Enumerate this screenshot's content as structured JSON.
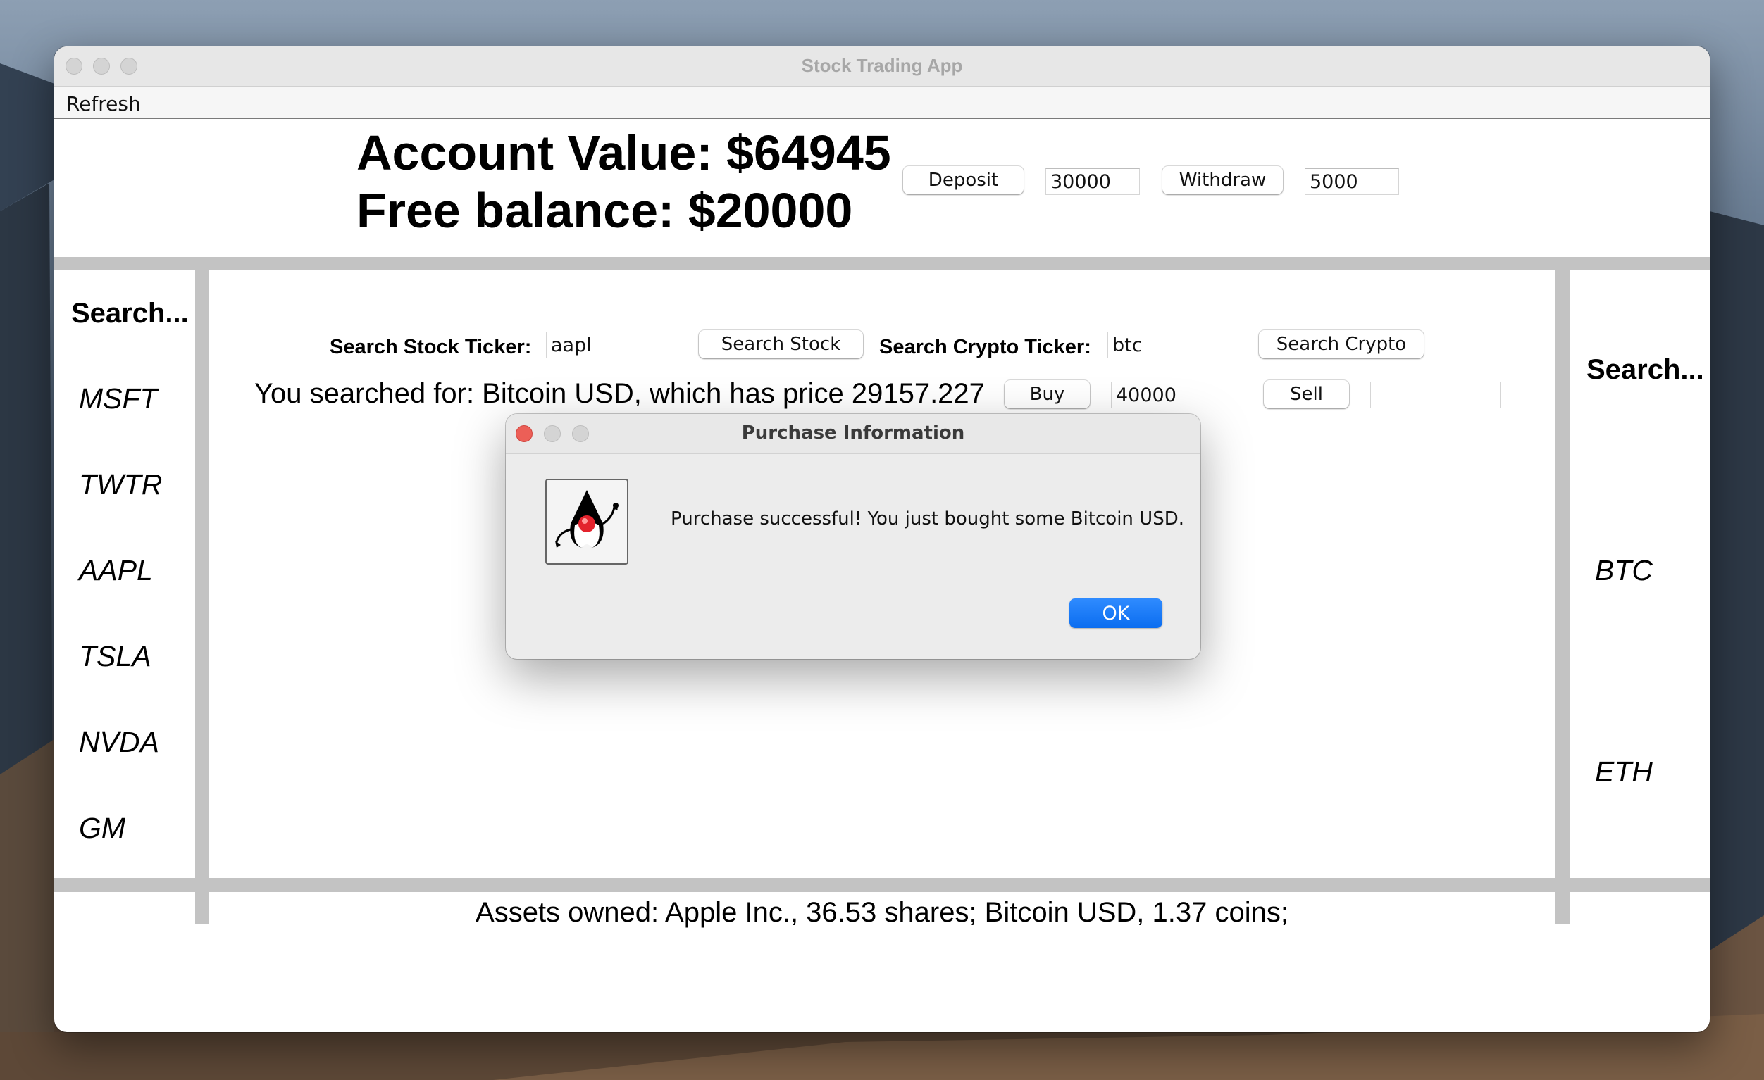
{
  "window": {
    "title": "Stock Trading App"
  },
  "menu": {
    "refresh": "Refresh"
  },
  "account": {
    "value_text": "Account Value: $64945",
    "balance_text": "Free balance: $20000",
    "deposit_label": "Deposit",
    "deposit_value": "30000",
    "withdraw_label": "Withdraw",
    "withdraw_value": "5000"
  },
  "search": {
    "stock_label": "Search Stock Ticker:",
    "stock_value": "aapl",
    "stock_button": "Search Stock",
    "crypto_label": "Search Crypto Ticker:",
    "crypto_value": "btc",
    "crypto_button": "Search Crypto"
  },
  "result": {
    "text": "You searched for: Bitcoin USD, which has price 29157.227",
    "buy_label": "Buy",
    "buy_value": "40000",
    "sell_label": "Sell",
    "sell_value": ""
  },
  "left_sidebar": {
    "heading": "Search...",
    "tickers": [
      "MSFT",
      "TWTR",
      "AAPL",
      "TSLA",
      "NVDA",
      "GM"
    ]
  },
  "right_sidebar": {
    "heading": "Search...",
    "tickers": [
      "BTC",
      "ETH"
    ]
  },
  "footer": {
    "assets_text": "Assets owned: Apple Inc., 36.53 shares; Bitcoin USD, 1.37 coins;"
  },
  "dialog": {
    "title": "Purchase Information",
    "message": "Purchase successful! You just bought some Bitcoin USD.",
    "ok_label": "OK",
    "close_color": "#ec5f57"
  }
}
